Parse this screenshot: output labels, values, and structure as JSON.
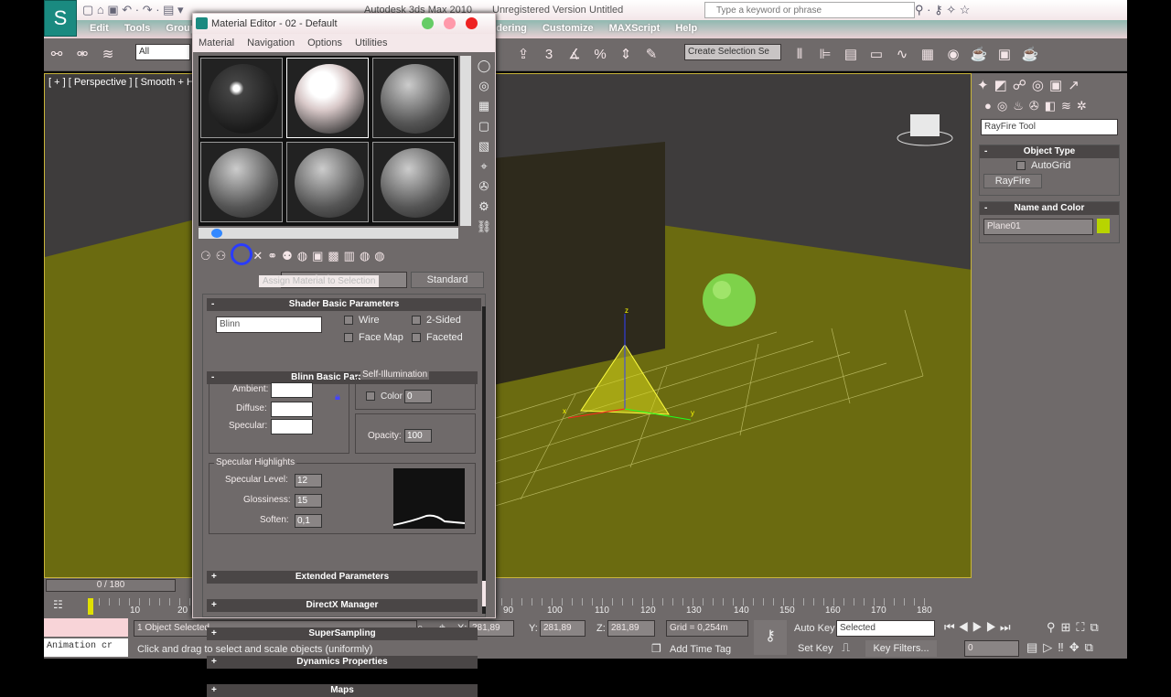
{
  "app": {
    "title": "Autodesk 3ds Max  2010",
    "version": "Unregistered Version",
    "file": "Untitled",
    "search_placeholder": "Type a keyword or phrase"
  },
  "menubar": [
    "Edit",
    "Tools",
    "Group",
    "Rendering",
    "Customize",
    "MAXScript",
    "Help"
  ],
  "toolbar": {
    "selection_filter": "All",
    "named_selection": "Create Selection Se"
  },
  "viewport": {
    "label": "[ + ] [ Perspective ] [ Smooth + Hig",
    "axis_x": "x",
    "axis_y": "y",
    "axis_z": "z",
    "ground_color": "#6b6b10",
    "sphere_color": "#7ed24a"
  },
  "material_editor": {
    "title": "Material Editor - 02 - Default",
    "menu": [
      "Material",
      "Navigation",
      "Options",
      "Utilities"
    ],
    "tooltip": "Assign Material to Selection",
    "material_name": "02 - Default",
    "material_type": "Standard",
    "shader_rollout": "Shader Basic Parameters",
    "shader": "Blinn",
    "wire": "Wire",
    "two_sided": "2-Sided",
    "face_map": "Face Map",
    "faceted": "Faceted",
    "blinn_rollout": "Blinn Basic Parameters",
    "self_illum": "Self-Illumination",
    "color_label": "Color",
    "color_value": "0",
    "ambient": "Ambient:",
    "diffuse": "Diffuse:",
    "specular": "Specular:",
    "opacity_label": "Opacity:",
    "opacity": "100",
    "spec_highlights": "Specular Highlights",
    "spec_level_label": "Specular Level:",
    "spec_level": "12",
    "gloss_label": "Glossiness:",
    "gloss": "15",
    "soften_label": "Soften:",
    "soften": "0,1",
    "rollouts": [
      "Extended Parameters",
      "DirectX Manager",
      "SuperSampling",
      "Dynamics Properties",
      "Maps"
    ]
  },
  "command_panel": {
    "dropdown": "RayFire Tool",
    "object_type": "Object Type",
    "autogrid": "AutoGrid",
    "rayfire_button": "RayFire",
    "name_color": "Name and Color",
    "object_name": "Plane01",
    "object_color": "#b8d400"
  },
  "timeline": {
    "frame": "0 / 180",
    "ticks": [
      "10",
      "20",
      "90",
      "100",
      "110",
      "120",
      "130",
      "140",
      "150",
      "160",
      "170",
      "180"
    ]
  },
  "status": {
    "selected": "1 Object Selected",
    "prompt": "Click and drag to select and scale objects (uniformly)",
    "maxscript": "Animation cr",
    "x": "281,89",
    "y": "281,89",
    "z": "281,89",
    "grid": "Grid = 0,254m",
    "add_time_tag": "Add Time Tag",
    "auto_key": "Auto Key",
    "set_key": "Set Key",
    "key_mode": "Selected",
    "key_filters": "Key Filters...",
    "current_frame": "0"
  }
}
